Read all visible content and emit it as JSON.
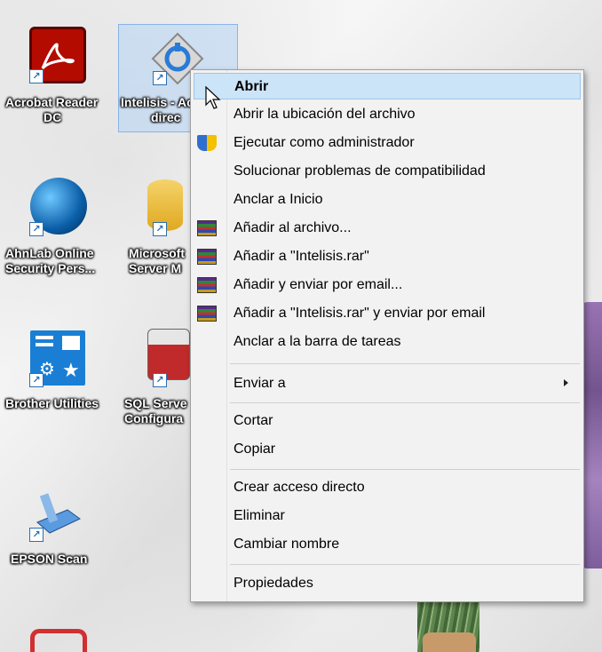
{
  "desktop": {
    "icons": [
      {
        "label1": "Acrobat Reader",
        "label2": "DC",
        "icon": "acrobat-icon",
        "color": "#b30b00"
      },
      {
        "label1": "Intelisis - Acc",
        "label2": "direc",
        "icon": "intelisis-icon",
        "color": "#2a7bd6"
      },
      {
        "label1": "AhnLab Online",
        "label2": "Security Pers...",
        "icon": "ahnlab-icon",
        "color": "#1f8fd8"
      },
      {
        "label1": "Microsoft",
        "label2": "Server M",
        "icon": "sql-server-icon",
        "color": "#e5b230"
      },
      {
        "label1": "Brother Utilities",
        "label2": "",
        "icon": "brother-icon",
        "color": "#1a7fd4"
      },
      {
        "label1": "SQL Serve",
        "label2": "Configura",
        "icon": "sql-config-icon",
        "color": "#c02a2a"
      },
      {
        "label1": "EPSON Scan",
        "label2": "",
        "icon": "epson-scan-icon",
        "color": "#4a8cd0"
      }
    ]
  },
  "menu": {
    "items": [
      {
        "label": "Abrir",
        "highlighted": true
      },
      {
        "label": "Abrir la ubicación del archivo"
      },
      {
        "label": "Ejecutar como administrador",
        "icon": "uac-shield-icon"
      },
      {
        "label": "Solucionar problemas de compatibilidad"
      },
      {
        "label": "Anclar a Inicio"
      },
      {
        "label": "Añadir al archivo...",
        "icon": "winrar-icon"
      },
      {
        "label": "Añadir a \"Intelisis.rar\"",
        "icon": "winrar-icon"
      },
      {
        "label": "Añadir y enviar por email...",
        "icon": "winrar-icon"
      },
      {
        "label": "Añadir a \"Intelisis.rar\" y enviar por email",
        "icon": "winrar-icon"
      },
      {
        "label": "Anclar a la barra de tareas"
      },
      {
        "label": "Enviar a",
        "submenu": true
      },
      {
        "label": "Cortar"
      },
      {
        "label": "Copiar"
      },
      {
        "label": "Crear acceso directo"
      },
      {
        "label": "Eliminar"
      },
      {
        "label": "Cambiar nombre"
      },
      {
        "label": "Propiedades"
      }
    ]
  }
}
